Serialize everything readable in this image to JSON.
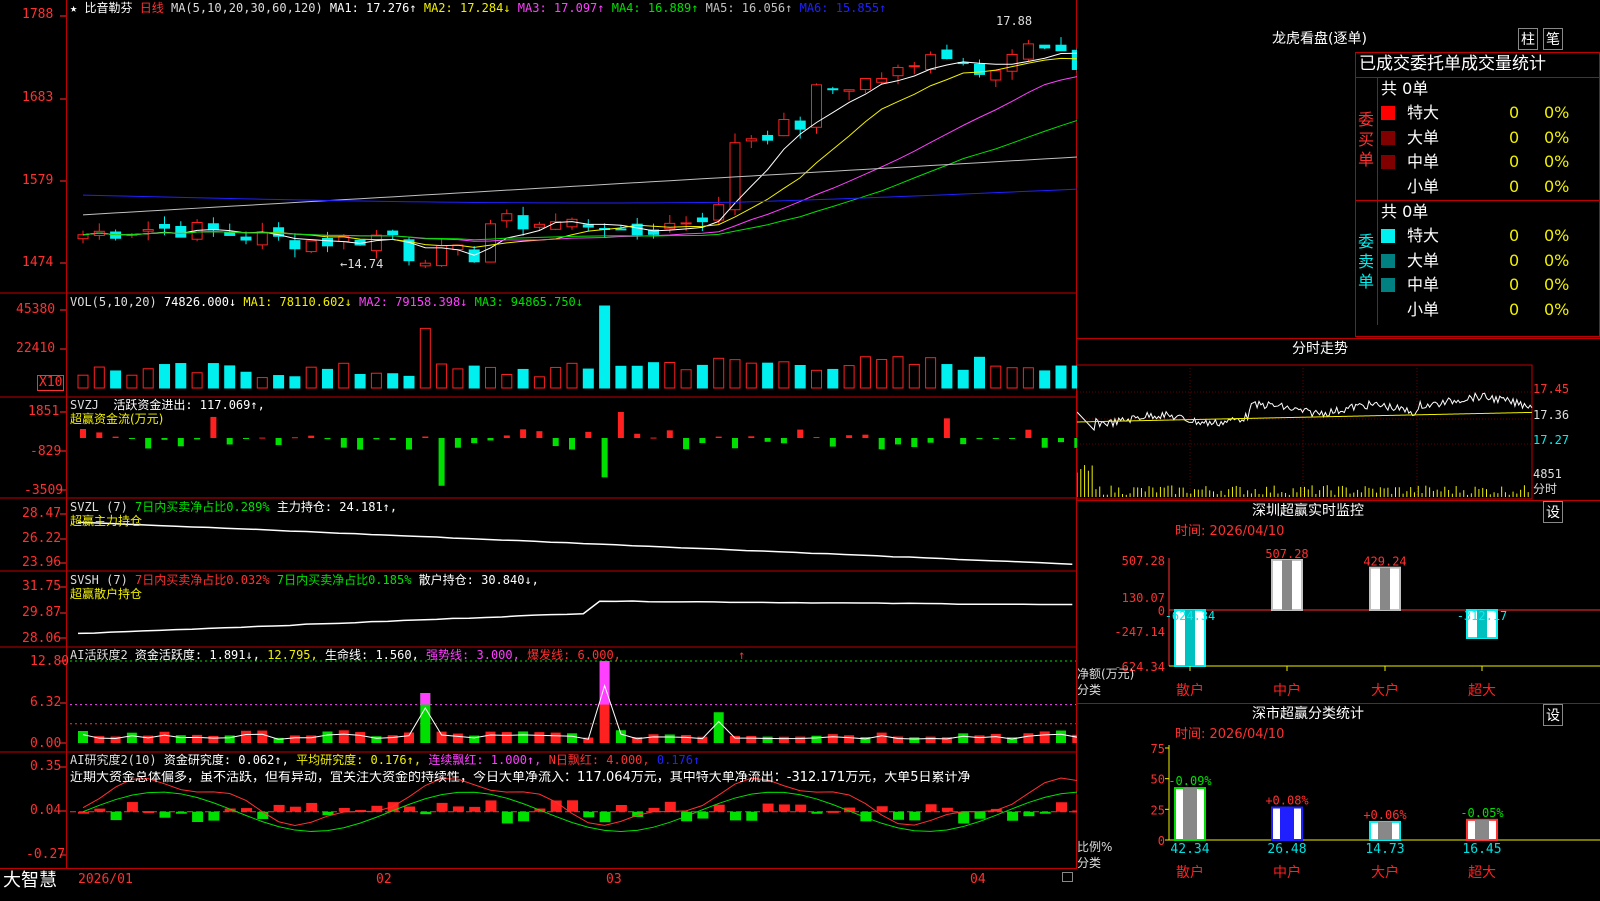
{
  "stock": {
    "name": "比音勒芬",
    "period": "日线",
    "star": "★"
  },
  "colors": {
    "up": "#ff2020",
    "down": "#00f0f0",
    "ma1": "#ffffff",
    "ma2": "#f0f000",
    "ma3": "#ff40ff",
    "ma4": "#00e000",
    "ma5": "#c0c0c0",
    "ma6": "#2020ff",
    "axis": "#ff3030",
    "border": "#c00000"
  },
  "main": {
    "ma_label": "MA(5,10,20,30,60,120)",
    "ma1": "MA1: 17.276↑",
    "ma2": "MA2: 17.284↓",
    "ma3": "MA3: 17.097↑",
    "ma4": "MA4: 16.889↑",
    "ma5": "MA5: 16.056↑",
    "ma6": "MA6: 15.855↑",
    "y_ticks": [
      "1788",
      "1683",
      "1579",
      "1474"
    ],
    "high_label": "17.88",
    "low_label": "←14.74"
  },
  "vol": {
    "title": "VOL(5,10,20)",
    "v": "74826.000↓",
    "ma1": "MA1: 78110.602↓",
    "ma2": "MA2: 79158.398↓",
    "ma3": "MA3: 94865.750↓",
    "y_ticks": [
      "45380",
      "22410"
    ],
    "unit": "X10"
  },
  "svzj": {
    "title": "SVZJ",
    "t1": "活跃资金进出: 117.069↑,",
    "t2": "超赢资金流(万元)",
    "y_ticks": [
      "1851",
      "-829",
      "-3509"
    ]
  },
  "svzl": {
    "title": "SVZL (7)",
    "t1": "7日内买卖净占比0.289%",
    "t2": "主力持仓: 24.181↑,",
    "t3": "超赢主力持仓",
    "y_ticks": [
      "28.47",
      "26.22",
      "23.96"
    ]
  },
  "svsh": {
    "title": "SVSH (7)",
    "t1": "7日内买卖净占比0.032%",
    "t2": "7日内买卖净占比0.185%",
    "t3": "散户持仓: 30.840↓,",
    "t4": "超赢散户持仓",
    "y_ticks": [
      "31.75",
      "29.87",
      "28.06"
    ]
  },
  "ai2": {
    "title": "AI活跃度2",
    "t1": "资金活跃度: 1.891↓,",
    "t2": "12.795,",
    "t3": "生命线: 1.560,",
    "t4": "强势线: 3.000,",
    "t5": "爆发线: 6.000,",
    "t6": "↑",
    "y_ticks": [
      "12.80",
      "6.32",
      "0.00"
    ]
  },
  "ai_res": {
    "title": "AI研究度2(10)",
    "t1": "资金研究度: 0.062↑,",
    "t2": "平均研究度: 0.176↑,",
    "t3": "连续飘红: 1.000↑,",
    "t4": "N日飘红: 4.000,",
    "t5": "0.176↑",
    "note": "近期大资金总体偏多，虽不活跃，但有异动，宜关注大资金的持续性，今日大单净流入：117.064万元，其中特大单净流出：-312.171万元，大单5日累计净",
    "y_ticks": [
      "0.35",
      "0.04",
      "-0.27"
    ]
  },
  "xaxis": {
    "labels": [
      "2026/01",
      "02",
      "03",
      "04"
    ]
  },
  "brand": "大智慧",
  "right": {
    "lh_title": "龙虎看盘(逐单)",
    "btn_bar": "柱",
    "btn_pen": "笔",
    "stat_title": "已成交委托单成交量统计",
    "buy": {
      "label": "委买单",
      "total": "共 0单",
      "rows": [
        {
          "name": "特大",
          "n": "0",
          "p": "0%"
        },
        {
          "name": "大单",
          "n": "0",
          "p": "0%"
        },
        {
          "name": "中单",
          "n": "0",
          "p": "0%"
        },
        {
          "name": "小单",
          "n": "0",
          "p": "0%"
        }
      ]
    },
    "sell": {
      "label": "委卖单",
      "total": "共 0单",
      "rows": [
        {
          "name": "特大",
          "n": "0",
          "p": "0%"
        },
        {
          "name": "大单",
          "n": "0",
          "p": "0%"
        },
        {
          "name": "中单",
          "n": "0",
          "p": "0%"
        },
        {
          "name": "小单",
          "n": "0",
          "p": "0%"
        }
      ]
    },
    "intraday": {
      "title": "分时走势",
      "p1": "17.45",
      "p2": "17.36",
      "p3": "17.27",
      "vol": "4851",
      "unit": "分时"
    },
    "sz_monitor": {
      "title": "深圳超赢实时监控",
      "time": "时间: 2026/04/10",
      "set": "设",
      "y_ticks": [
        "507.28",
        "130.07",
        "0",
        "-247.14",
        "-624.34"
      ],
      "ylabel": "净额(万元)",
      "xlabel": "分类",
      "cats": [
        "散户",
        "中户",
        "大户",
        "超大"
      ]
    },
    "sz_class": {
      "title": "深市超赢分类统计",
      "time": "时间: 2026/04/10",
      "set": "设",
      "y_ticks": [
        "75",
        "50",
        "25",
        "0"
      ],
      "ylabel": "比例%",
      "xlabel": "分类",
      "cats": [
        "散户",
        "中户",
        "大户",
        "超大"
      ]
    }
  },
  "chart_data": [
    {
      "type": "bar",
      "title": "深圳超赢实时监控",
      "categories": [
        "散户",
        "中户",
        "大户",
        "超大"
      ],
      "values": [
        -624.34,
        507.28,
        429.24,
        -312.17
      ],
      "ylabel": "净额(万元)",
      "xlabel": "分类",
      "ylim": [
        -624.34,
        507.28
      ]
    },
    {
      "type": "bar",
      "title": "深市超赢分类统计",
      "categories": [
        "散户",
        "中户",
        "大户",
        "超大"
      ],
      "series": [
        {
          "values": [
            42.34,
            26.48,
            14.73,
            16.45
          ]
        },
        {
          "values": [
            -0.09,
            0.08,
            0.06,
            -0.05
          ]
        }
      ],
      "ylabel": "比例%",
      "xlabel": "分类",
      "ylim": [
        0,
        75
      ]
    }
  ]
}
